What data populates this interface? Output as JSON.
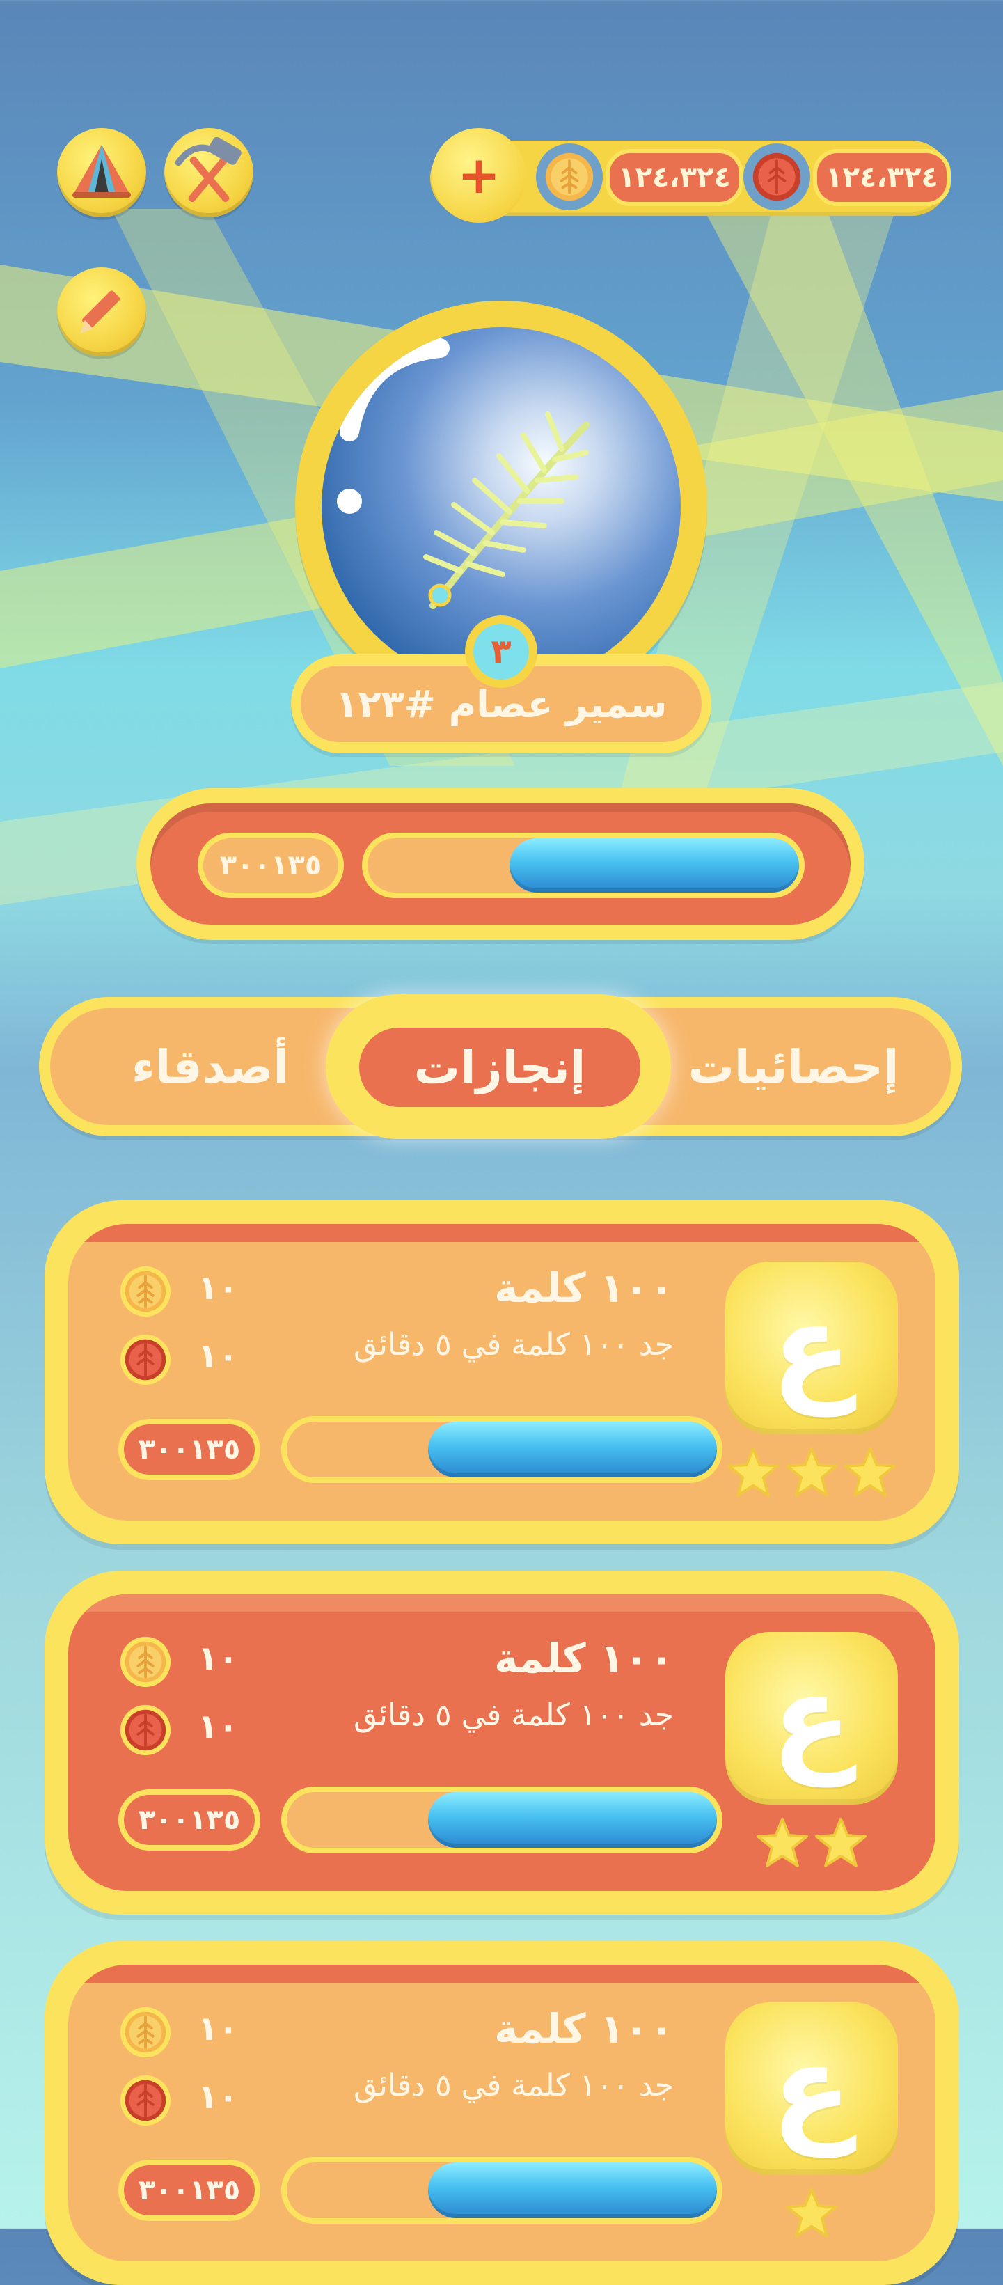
{
  "header": {
    "camp_icon": "tent-icon",
    "tools_icon": "hammer-pickaxe-icon",
    "edit_icon": "pencil-icon",
    "add_label": "+",
    "gold_coins": "١٢٤،٣٢٤",
    "red_gems": "١٢٤،٣٢٤"
  },
  "profile": {
    "avatar_icon": "palm-leaf-orb-icon",
    "level": "٣",
    "name": "سمير عصام #١٢٣",
    "xp_text": "٣٠٠١٣٥",
    "xp_progress": 0.68
  },
  "tabs": [
    {
      "label": "إحصائيات",
      "active": false
    },
    {
      "label": "إنجازات",
      "active": true
    },
    {
      "label": "أصدقاء",
      "active": false
    }
  ],
  "achievements": [
    {
      "letter": "ع",
      "title": "١٠٠ كلمة",
      "description": "جد ١٠٠ كلمة في ٥ دقائق",
      "reward_coins": "١٠",
      "reward_gems": "١٠",
      "progress_text": "٣٠٠١٣٥",
      "progress": 0.68,
      "stars": 3,
      "variant": "orange"
    },
    {
      "letter": "ع",
      "title": "١٠٠ كلمة",
      "description": "جد ١٠٠ كلمة في ٥ دقائق",
      "reward_coins": "١٠",
      "reward_gems": "١٠",
      "progress_text": "٣٠٠١٣٥",
      "progress": 0.68,
      "stars": 2,
      "variant": "red"
    },
    {
      "letter": "ع",
      "title": "١٠٠ كلمة",
      "description": "جد ١٠٠ كلمة في ٥ دقائق",
      "reward_coins": "١٠",
      "reward_gems": "١٠",
      "progress_text": "٣٠٠١٣٥",
      "progress": 0.68,
      "stars": 1,
      "variant": "orange"
    }
  ],
  "colors": {
    "yellow": "#fbe35e",
    "orange": "#f7b76b",
    "red": "#e9714f",
    "blue_fill": "#46bff0"
  }
}
